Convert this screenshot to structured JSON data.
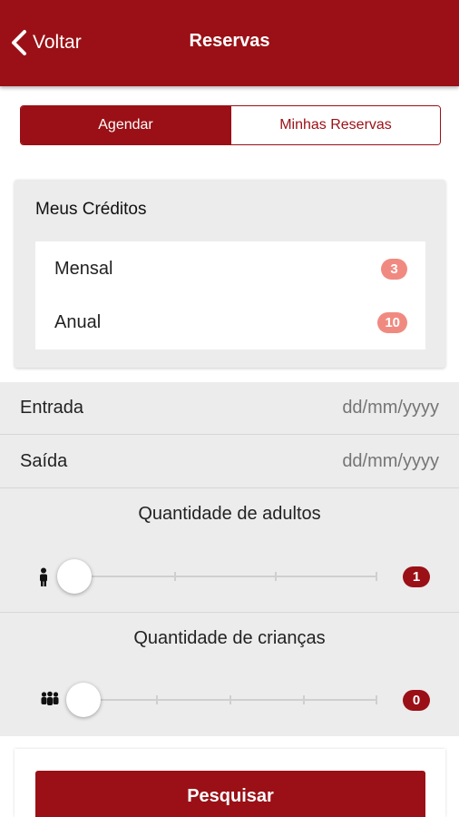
{
  "header": {
    "back_label": "Voltar",
    "title": "Reservas"
  },
  "tabs": {
    "active_label": "Agendar",
    "inactive_label": "Minhas Reservas"
  },
  "credits": {
    "title": "Meus Créditos",
    "items": [
      {
        "label": "Mensal",
        "count": "3"
      },
      {
        "label": "Anual",
        "count": "10"
      }
    ]
  },
  "form": {
    "checkin": {
      "label": "Entrada",
      "placeholder": "dd/mm/yyyy"
    },
    "checkout": {
      "label": "Saída",
      "placeholder": "dd/mm/yyyy"
    },
    "adults": {
      "title": "Quantidade de adultos",
      "value": "1",
      "icon": "person-icon"
    },
    "children": {
      "title": "Quantidade de crianças",
      "value": "0",
      "icon": "group-icon"
    }
  },
  "search_label": "Pesquisar",
  "colors": {
    "brand": "#9a1016",
    "credit_badge": "#f08a80",
    "panel": "#ececec"
  }
}
